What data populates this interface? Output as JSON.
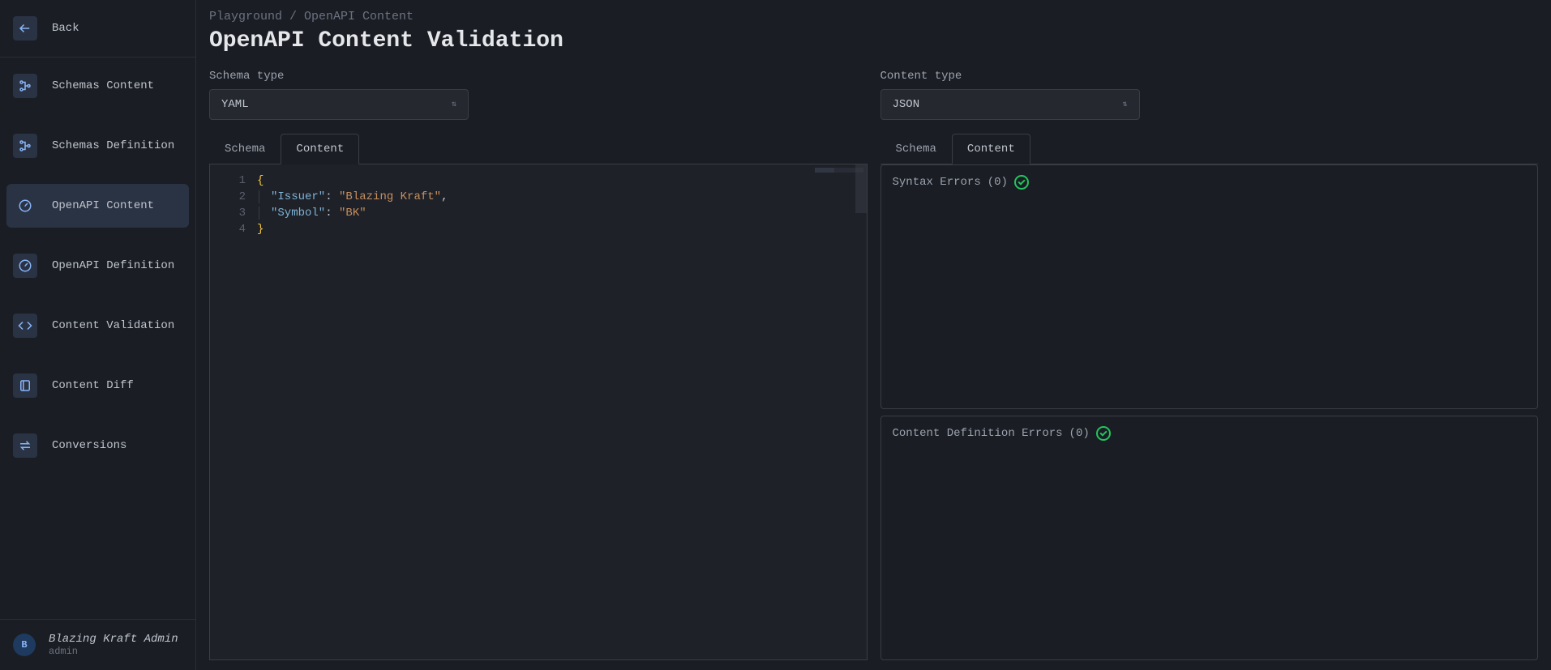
{
  "sidebar": {
    "back_label": "Back",
    "items": [
      {
        "label": "Schemas Content",
        "icon": "flow-icon"
      },
      {
        "label": "Schemas Definition",
        "icon": "flow-icon"
      },
      {
        "label": "OpenAPI Content",
        "icon": "gauge-icon",
        "active": true
      },
      {
        "label": "OpenAPI Definition",
        "icon": "gauge-icon"
      },
      {
        "label": "Content Validation",
        "icon": "code-icon"
      },
      {
        "label": "Content Diff",
        "icon": "diff-icon"
      },
      {
        "label": "Conversions",
        "icon": "swap-icon"
      }
    ],
    "user": {
      "avatar_initial": "B",
      "name": "Blazing Kraft Admin",
      "role": "admin"
    }
  },
  "breadcrumb": "Playground / OpenAPI Content",
  "page_title": "OpenAPI Content Validation",
  "left": {
    "schema_type_label": "Schema type",
    "schema_type_value": "YAML",
    "tabs": {
      "schema": "Schema",
      "content": "Content",
      "active": "content"
    },
    "editor": {
      "lines": [
        {
          "n": "1",
          "html": "{"
        },
        {
          "n": "2",
          "html": "    \"Issuer\": \"Blazing Kraft\","
        },
        {
          "n": "3",
          "html": "    \"Symbol\": \"BK\""
        },
        {
          "n": "4",
          "html": "}"
        }
      ],
      "content_object": {
        "Issuer": "Blazing Kraft",
        "Symbol": "BK"
      }
    }
  },
  "right": {
    "content_type_label": "Content type",
    "content_type_value": "JSON",
    "tabs": {
      "schema": "Schema",
      "content": "Content",
      "active": "content"
    },
    "syntax_errors_label": "Syntax Errors",
    "syntax_errors_count": "(0)",
    "definition_errors_label": "Content Definition Errors",
    "definition_errors_count": "(0)"
  }
}
